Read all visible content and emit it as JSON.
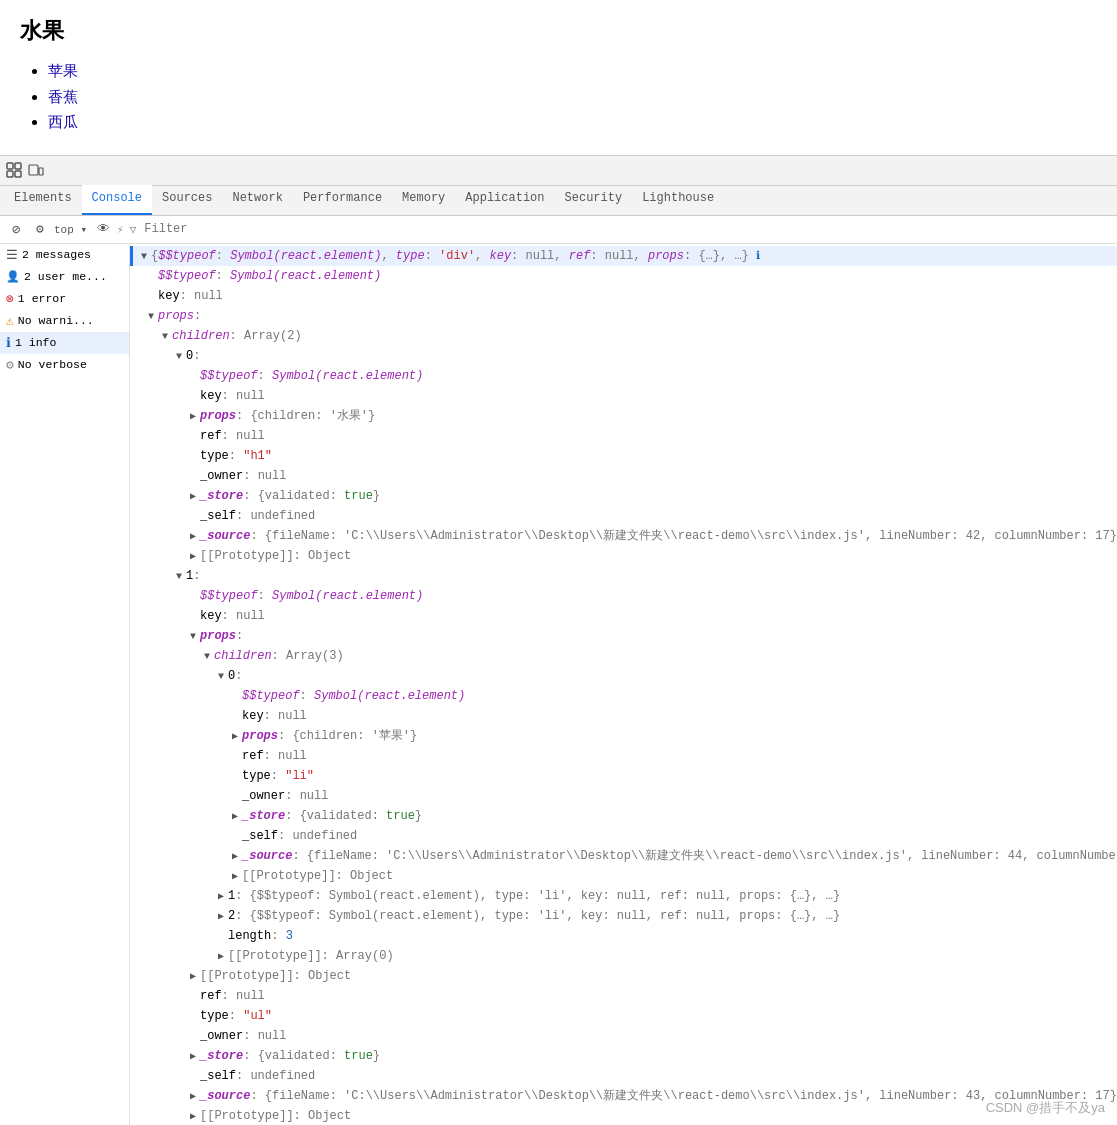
{
  "page": {
    "title": "水果",
    "list_items": [
      "苹果",
      "香蕉",
      "西瓜"
    ]
  },
  "devtools": {
    "toolbar": {
      "icons": [
        "inspect",
        "responsive",
        "settings"
      ]
    },
    "tabs": [
      {
        "label": "Elements",
        "active": false
      },
      {
        "label": "Console",
        "active": true
      },
      {
        "label": "Sources",
        "active": false
      },
      {
        "label": "Network",
        "active": false
      },
      {
        "label": "Performance",
        "active": false
      },
      {
        "label": "Memory",
        "active": false
      },
      {
        "label": "Application",
        "active": false
      },
      {
        "label": "Security",
        "active": false
      },
      {
        "label": "Lighthouse",
        "active": false
      }
    ],
    "filter_bar": {
      "context": "top",
      "filter_placeholder": "Filter"
    },
    "sidebar": {
      "items": [
        {
          "id": "messages",
          "icon": "☰",
          "label": "2 messages",
          "count": "",
          "active": false
        },
        {
          "id": "users",
          "icon": "👤",
          "label": "2 user me...",
          "count": "",
          "active": false
        },
        {
          "id": "errors",
          "icon": "⊗",
          "label": "1 error",
          "count": "",
          "active": false
        },
        {
          "id": "warnings",
          "icon": "⚠",
          "label": "No warni...",
          "count": "",
          "active": false
        },
        {
          "id": "info",
          "icon": "ℹ",
          "label": "1 info",
          "count": "",
          "active": true
        },
        {
          "id": "verbose",
          "icon": "⚙",
          "label": "No verbose",
          "count": "",
          "active": false
        }
      ]
    }
  },
  "watermark": "CSDN @措手不及ya"
}
